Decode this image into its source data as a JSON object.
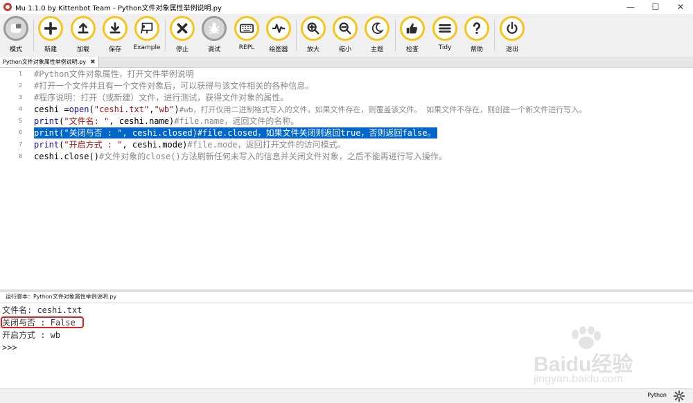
{
  "window": {
    "title": "Mu 1.1.0 by Kittenbot Team - Python文件对象属性举例说明.py",
    "minimize": "—",
    "maximize": "☐",
    "close": "✕"
  },
  "toolbar": {
    "mode": "模式",
    "new": "新建",
    "load": "加载",
    "save": "保存",
    "example": "Example",
    "stop": "停止",
    "debug": "调试",
    "repl": "REPL",
    "plotter": "绘图器",
    "zoom_in": "放大",
    "zoom_out": "缩小",
    "theme": "主题",
    "check": "检查",
    "tidy": "Tidy",
    "help": "帮助",
    "quit": "退出"
  },
  "tab": {
    "label": "Python文件对象属性举例说明.py",
    "close": "✖"
  },
  "editor": {
    "lines": [
      {
        "num": "1",
        "comment": "#Python文件对象属性，打开文件举例说明"
      },
      {
        "num": "2",
        "comment": "#打开一个文件并且有一个文件对象后，可以获得与该文件相关的各种信息。"
      },
      {
        "num": "3",
        "comment": "#程序说明：打开（或新建）文件，进行测试，获得文件对象的属性。"
      },
      {
        "num": "4",
        "p1": "ceshi = ",
        "kw": "open",
        "p2": "(",
        "s1": "\"ceshi.txt\"",
        "p3": ", ",
        "s2": "\"wb\"",
        "p4": ")",
        "comment": "#wb，打开仅用二进制格式写入的文件。如果文件存在，则覆盖该文件。 如果文件不存在，则创建一个新文件进行写入。"
      },
      {
        "num": "5",
        "kw": "print",
        "p1": " (",
        "s1": "\"文件名: \"",
        "p2": ", ceshi.name)",
        "comment": "#file.name，返回文件的名称。"
      },
      {
        "num": "6",
        "kw": "print",
        "p1": " (",
        "s1": "\"关闭与否 : \"",
        "p2": ", ceshi.closed)",
        "comment": "#file.closed，如果文件关闭则返回true，否则返回false。"
      },
      {
        "num": "7",
        "kw": "print",
        "p1": " (",
        "s1": "\"开启方式 : \"",
        "p2": ", ceshi.mode)",
        "comment": "#file.mode，返回打开文件的访问模式。"
      },
      {
        "num": "8",
        "p1": "ceshi.close()",
        "comment": "#文件对象的close()方法刷新任何未写入的信息并关闭文件对象，之后不能再进行写入操作。"
      }
    ]
  },
  "repl": {
    "run_label": "运行脚本：Python文件对象属性举例说明.py",
    "output": [
      "文件名:  ceshi.txt",
      "关闭与否 :  False",
      "开启方式 :  wb",
      ">>>"
    ]
  },
  "watermark": {
    "main": "Baidu经验",
    "sub": "jingyan.baidu.com"
  },
  "status": {
    "mode": "Python"
  },
  "colors": {
    "accent": "#f5c518",
    "selection": "#0066cc",
    "highlight_box": "#e02020"
  }
}
